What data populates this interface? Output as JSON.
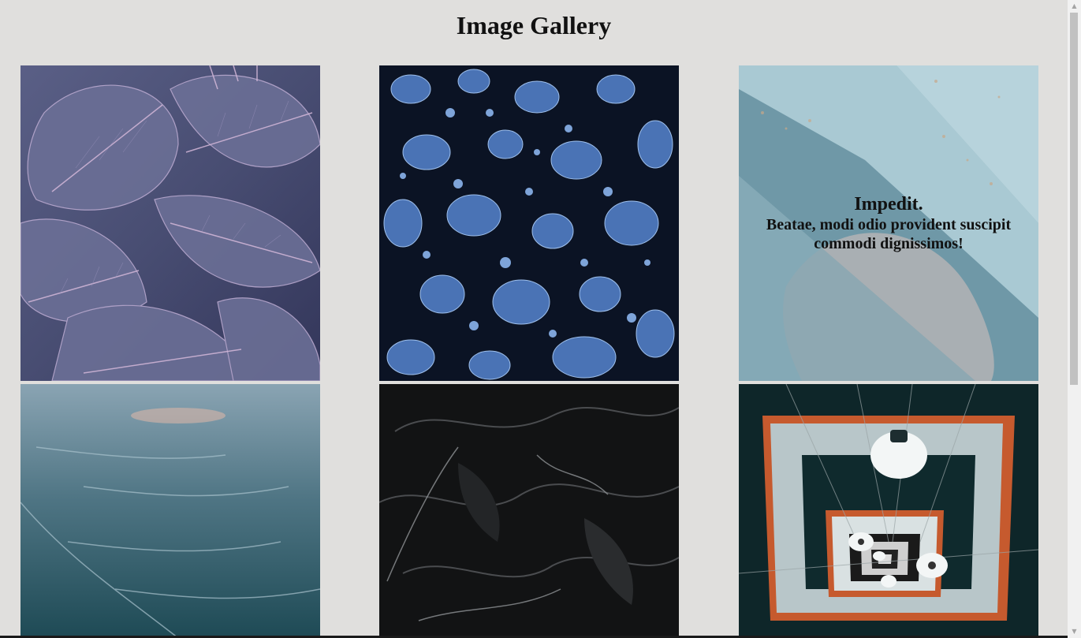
{
  "header": {
    "title": "Image Gallery"
  },
  "gallery": {
    "items": [
      {
        "image": "monstera-leaves-image"
      },
      {
        "image": "water-droplets-image"
      },
      {
        "image": "blue-rock-image",
        "overlay_title": "Impedit.",
        "overlay_text": "Beatae, modi odio provident suscipit commodi dignissimos!"
      },
      {
        "image": "sea-water-image"
      },
      {
        "image": "black-plastic-image"
      },
      {
        "image": "spiral-stairwell-image"
      }
    ]
  },
  "scrollbar": {
    "up_icon": "arrow-up-icon",
    "down_icon": "arrow-down-icon"
  },
  "colors": {
    "background": "#e0dfdd",
    "text": "#111111"
  }
}
